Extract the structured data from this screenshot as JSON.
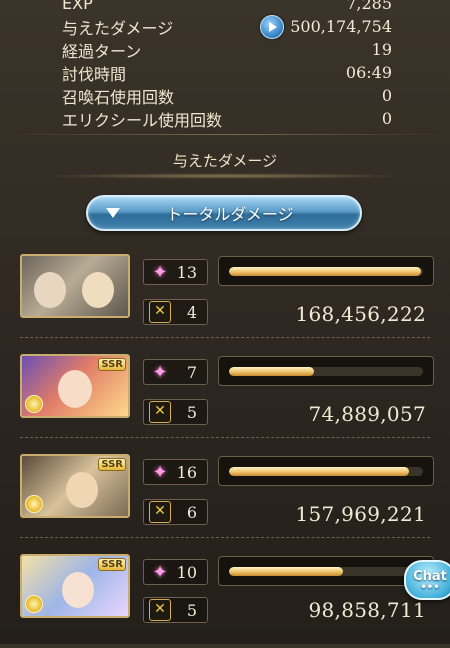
{
  "stats": [
    {
      "label": "EXP",
      "value": "7,285"
    },
    {
      "label": "与えたダメージ",
      "value": "500,174,754"
    },
    {
      "label": "経過ターン",
      "value": "19"
    },
    {
      "label": "討伐時間",
      "value": "06:49"
    },
    {
      "label": "召喚石使用回数",
      "value": "0"
    },
    {
      "label": "エリクシール使用回数",
      "value": "0"
    }
  ],
  "section_title": "与えたダメージ",
  "dropdown": {
    "label": "トータルダメージ"
  },
  "characters": [
    {
      "portrait": "character-portrait-1",
      "ssr": "",
      "stars": "13",
      "skills": "4",
      "bar_fraction": 0.99,
      "damage": "168,456,222"
    },
    {
      "portrait": "character-portrait-2",
      "ssr": "SSR",
      "stars": "7",
      "skills": "5",
      "bar_fraction": 0.44,
      "damage": "74,889,057"
    },
    {
      "portrait": "character-portrait-3",
      "ssr": "SSR",
      "stars": "16",
      "skills": "6",
      "bar_fraction": 0.93,
      "damage": "157,969,221"
    },
    {
      "portrait": "character-portrait-4",
      "ssr": "SSR",
      "stars": "10",
      "skills": "5",
      "bar_fraction": 0.59,
      "damage": "98,858,711"
    }
  ],
  "chat": {
    "label": "Chat",
    "dots": "•••"
  },
  "icons": {
    "play": "play-icon",
    "star": "star-icon",
    "skill": "skill-icon",
    "element": "element-icon",
    "dropdown": "chevron-down-icon"
  }
}
